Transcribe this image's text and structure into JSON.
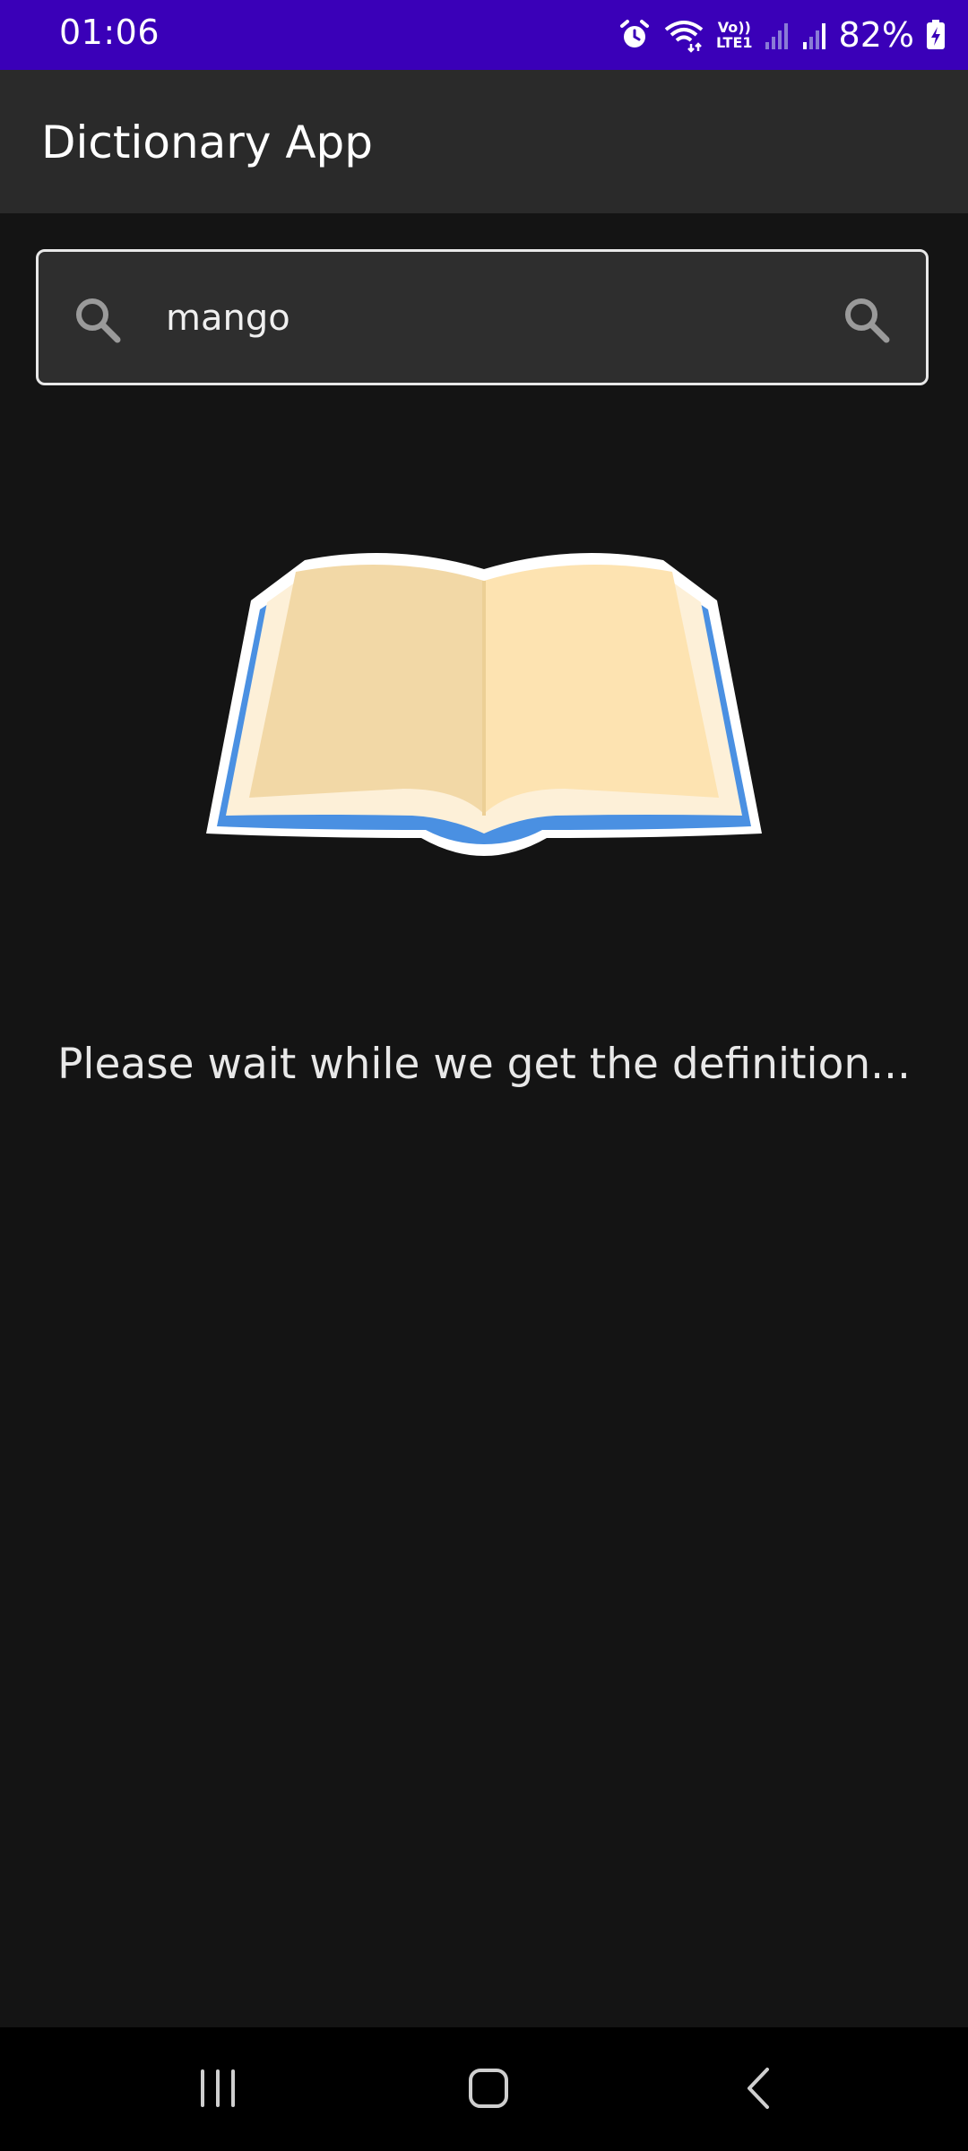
{
  "status_bar": {
    "time": "01:06",
    "battery": "82%",
    "icons": [
      "alarm-icon",
      "wifi-icon",
      "volte-icon",
      "signal-icon",
      "signal-icon",
      "battery-charging-icon"
    ],
    "lte_label": "LTE1",
    "volte_label": "Vo))",
    "background_color": "#3a00b8"
  },
  "app_bar": {
    "title": "Dictionary App"
  },
  "search": {
    "value": "mango",
    "leading_icon": "search-icon",
    "trailing_icon": "search-icon"
  },
  "main": {
    "illustration": "open-book-icon",
    "loading_message": "Please wait while we get the definition..."
  },
  "nav_bar": {
    "buttons": [
      "recent-apps-icon",
      "home-icon",
      "back-icon"
    ]
  }
}
